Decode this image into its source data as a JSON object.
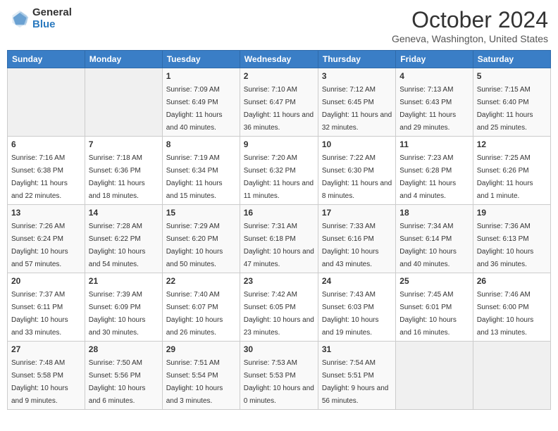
{
  "header": {
    "logo_general": "General",
    "logo_blue": "Blue",
    "month_title": "October 2024",
    "location": "Geneva, Washington, United States"
  },
  "days_of_week": [
    "Sunday",
    "Monday",
    "Tuesday",
    "Wednesday",
    "Thursday",
    "Friday",
    "Saturday"
  ],
  "weeks": [
    [
      {
        "day": "",
        "sunrise": "",
        "sunset": "",
        "daylight": ""
      },
      {
        "day": "",
        "sunrise": "",
        "sunset": "",
        "daylight": ""
      },
      {
        "day": "1",
        "sunrise": "Sunrise: 7:09 AM",
        "sunset": "Sunset: 6:49 PM",
        "daylight": "Daylight: 11 hours and 40 minutes."
      },
      {
        "day": "2",
        "sunrise": "Sunrise: 7:10 AM",
        "sunset": "Sunset: 6:47 PM",
        "daylight": "Daylight: 11 hours and 36 minutes."
      },
      {
        "day": "3",
        "sunrise": "Sunrise: 7:12 AM",
        "sunset": "Sunset: 6:45 PM",
        "daylight": "Daylight: 11 hours and 32 minutes."
      },
      {
        "day": "4",
        "sunrise": "Sunrise: 7:13 AM",
        "sunset": "Sunset: 6:43 PM",
        "daylight": "Daylight: 11 hours and 29 minutes."
      },
      {
        "day": "5",
        "sunrise": "Sunrise: 7:15 AM",
        "sunset": "Sunset: 6:40 PM",
        "daylight": "Daylight: 11 hours and 25 minutes."
      }
    ],
    [
      {
        "day": "6",
        "sunrise": "Sunrise: 7:16 AM",
        "sunset": "Sunset: 6:38 PM",
        "daylight": "Daylight: 11 hours and 22 minutes."
      },
      {
        "day": "7",
        "sunrise": "Sunrise: 7:18 AM",
        "sunset": "Sunset: 6:36 PM",
        "daylight": "Daylight: 11 hours and 18 minutes."
      },
      {
        "day": "8",
        "sunrise": "Sunrise: 7:19 AM",
        "sunset": "Sunset: 6:34 PM",
        "daylight": "Daylight: 11 hours and 15 minutes."
      },
      {
        "day": "9",
        "sunrise": "Sunrise: 7:20 AM",
        "sunset": "Sunset: 6:32 PM",
        "daylight": "Daylight: 11 hours and 11 minutes."
      },
      {
        "day": "10",
        "sunrise": "Sunrise: 7:22 AM",
        "sunset": "Sunset: 6:30 PM",
        "daylight": "Daylight: 11 hours and 8 minutes."
      },
      {
        "day": "11",
        "sunrise": "Sunrise: 7:23 AM",
        "sunset": "Sunset: 6:28 PM",
        "daylight": "Daylight: 11 hours and 4 minutes."
      },
      {
        "day": "12",
        "sunrise": "Sunrise: 7:25 AM",
        "sunset": "Sunset: 6:26 PM",
        "daylight": "Daylight: 11 hours and 1 minute."
      }
    ],
    [
      {
        "day": "13",
        "sunrise": "Sunrise: 7:26 AM",
        "sunset": "Sunset: 6:24 PM",
        "daylight": "Daylight: 10 hours and 57 minutes."
      },
      {
        "day": "14",
        "sunrise": "Sunrise: 7:28 AM",
        "sunset": "Sunset: 6:22 PM",
        "daylight": "Daylight: 10 hours and 54 minutes."
      },
      {
        "day": "15",
        "sunrise": "Sunrise: 7:29 AM",
        "sunset": "Sunset: 6:20 PM",
        "daylight": "Daylight: 10 hours and 50 minutes."
      },
      {
        "day": "16",
        "sunrise": "Sunrise: 7:31 AM",
        "sunset": "Sunset: 6:18 PM",
        "daylight": "Daylight: 10 hours and 47 minutes."
      },
      {
        "day": "17",
        "sunrise": "Sunrise: 7:33 AM",
        "sunset": "Sunset: 6:16 PM",
        "daylight": "Daylight: 10 hours and 43 minutes."
      },
      {
        "day": "18",
        "sunrise": "Sunrise: 7:34 AM",
        "sunset": "Sunset: 6:14 PM",
        "daylight": "Daylight: 10 hours and 40 minutes."
      },
      {
        "day": "19",
        "sunrise": "Sunrise: 7:36 AM",
        "sunset": "Sunset: 6:13 PM",
        "daylight": "Daylight: 10 hours and 36 minutes."
      }
    ],
    [
      {
        "day": "20",
        "sunrise": "Sunrise: 7:37 AM",
        "sunset": "Sunset: 6:11 PM",
        "daylight": "Daylight: 10 hours and 33 minutes."
      },
      {
        "day": "21",
        "sunrise": "Sunrise: 7:39 AM",
        "sunset": "Sunset: 6:09 PM",
        "daylight": "Daylight: 10 hours and 30 minutes."
      },
      {
        "day": "22",
        "sunrise": "Sunrise: 7:40 AM",
        "sunset": "Sunset: 6:07 PM",
        "daylight": "Daylight: 10 hours and 26 minutes."
      },
      {
        "day": "23",
        "sunrise": "Sunrise: 7:42 AM",
        "sunset": "Sunset: 6:05 PM",
        "daylight": "Daylight: 10 hours and 23 minutes."
      },
      {
        "day": "24",
        "sunrise": "Sunrise: 7:43 AM",
        "sunset": "Sunset: 6:03 PM",
        "daylight": "Daylight: 10 hours and 19 minutes."
      },
      {
        "day": "25",
        "sunrise": "Sunrise: 7:45 AM",
        "sunset": "Sunset: 6:01 PM",
        "daylight": "Daylight: 10 hours and 16 minutes."
      },
      {
        "day": "26",
        "sunrise": "Sunrise: 7:46 AM",
        "sunset": "Sunset: 6:00 PM",
        "daylight": "Daylight: 10 hours and 13 minutes."
      }
    ],
    [
      {
        "day": "27",
        "sunrise": "Sunrise: 7:48 AM",
        "sunset": "Sunset: 5:58 PM",
        "daylight": "Daylight: 10 hours and 9 minutes."
      },
      {
        "day": "28",
        "sunrise": "Sunrise: 7:50 AM",
        "sunset": "Sunset: 5:56 PM",
        "daylight": "Daylight: 10 hours and 6 minutes."
      },
      {
        "day": "29",
        "sunrise": "Sunrise: 7:51 AM",
        "sunset": "Sunset: 5:54 PM",
        "daylight": "Daylight: 10 hours and 3 minutes."
      },
      {
        "day": "30",
        "sunrise": "Sunrise: 7:53 AM",
        "sunset": "Sunset: 5:53 PM",
        "daylight": "Daylight: 10 hours and 0 minutes."
      },
      {
        "day": "31",
        "sunrise": "Sunrise: 7:54 AM",
        "sunset": "Sunset: 5:51 PM",
        "daylight": "Daylight: 9 hours and 56 minutes."
      },
      {
        "day": "",
        "sunrise": "",
        "sunset": "",
        "daylight": ""
      },
      {
        "day": "",
        "sunrise": "",
        "sunset": "",
        "daylight": ""
      }
    ]
  ]
}
